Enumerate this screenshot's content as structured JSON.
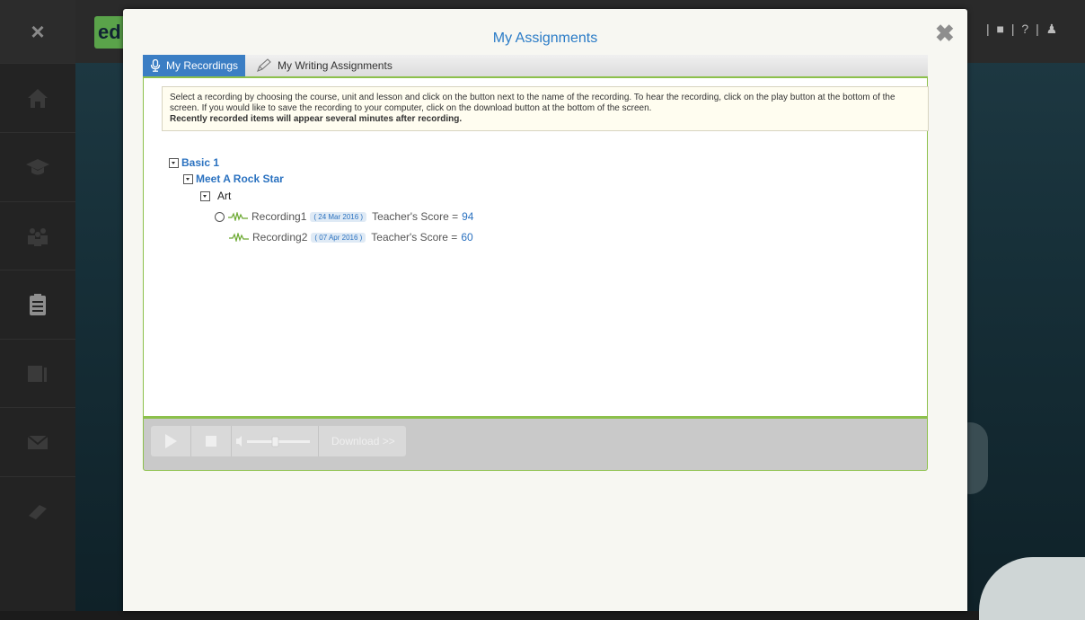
{
  "background": {
    "rail_close": "×",
    "logo_text": "ed",
    "top_links": "| ■ | ? | ♟"
  },
  "modal": {
    "title": "My Assignments",
    "close": "✖",
    "tabs": [
      {
        "label": "My Recordings",
        "icon": "microphone-icon",
        "active": true
      },
      {
        "label": "My Writing Assignments",
        "icon": "pencil-icon",
        "active": false
      }
    ],
    "notice": {
      "text": "Select a recording by choosing the course, unit and lesson and click on the button next to the name of the recording. To hear the recording, click on the play button at the bottom of the screen. If you would like to save the recording to your computer, click on the download button at the bottom of the screen.",
      "bold": "Recently recorded items will appear several minutes after recording."
    },
    "tree": {
      "course": "Basic 1",
      "unit": "Meet A Rock Star",
      "lesson": "Art",
      "recordings": [
        {
          "name": "Recording1",
          "date": "( 24 Mar 2016 )",
          "score_label": "Teacher's Score =",
          "score": "94",
          "has_radio": true
        },
        {
          "name": "Recording2",
          "date": "( 07 Apr 2016 )",
          "score_label": "Teacher's Score =",
          "score": "60",
          "has_radio": false
        }
      ]
    },
    "player": {
      "download_label": "Download >>",
      "volume_level": 0.45
    }
  },
  "colors": {
    "accent": "#2b7cc7",
    "green_border": "#8cc04b",
    "wave_green": "#6aa82f"
  }
}
